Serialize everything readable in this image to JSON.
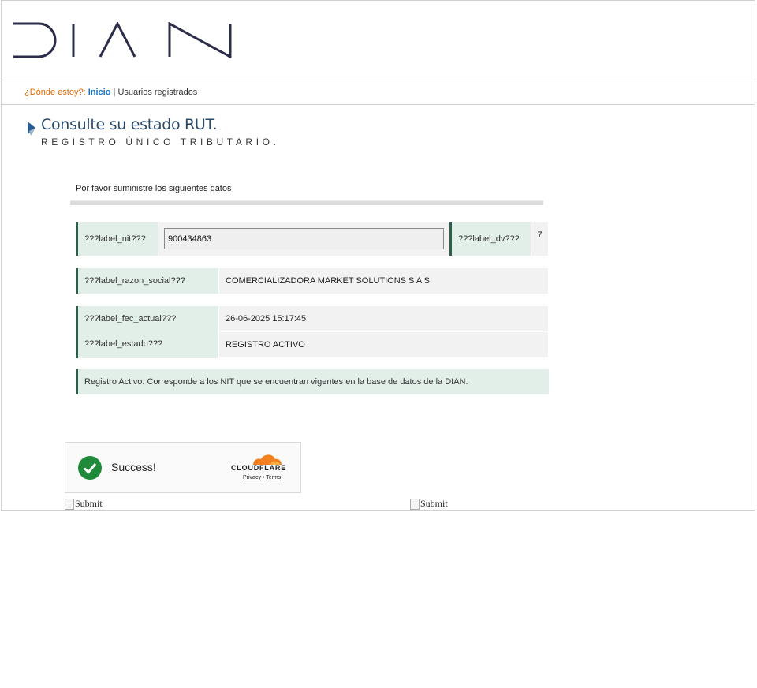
{
  "header": {
    "logo_text": "DIAN"
  },
  "breadcrumb": {
    "where": "¿Dónde estoy?:",
    "home": "Inicio",
    "separator": "|",
    "current": "Usuarios registrados"
  },
  "page": {
    "title": "Consulte su estado RUT.",
    "subtitle": "REGISTRO ÚNICO TRIBUTARIO."
  },
  "form": {
    "instructions": "Por favor suministre los siguientes datos",
    "nit": {
      "label": "???label_nit???",
      "value": "900434863"
    },
    "dv": {
      "label": "???label_dv???",
      "value": "7"
    },
    "razon_social": {
      "label": "???label_razon_social???",
      "value": "COMERCIALIZADORA MARKET SOLUTIONS S A S"
    },
    "fecha_actual": {
      "label": "???label_fec_actual???",
      "value": "26-06-2025 15:17:45"
    },
    "estado": {
      "label": "???label_estado???",
      "value": "REGISTRO ACTIVO"
    },
    "note": "Registro Activo: Corresponde a los NIT que se encuentran vigentes en la base de datos de la DIAN."
  },
  "captcha": {
    "status": "Success!",
    "brand": "CLOUDFLARE",
    "privacy": "Privacy",
    "dot": "•",
    "terms": "Terms"
  },
  "buttons": {
    "submit_left": "Submit",
    "submit_right": "Submit"
  },
  "colors": {
    "logo": "#2b2d4a",
    "accent_green": "#2e5e49",
    "label_bg": "#e2efe9",
    "breadcrumb_where": "#e06a00",
    "breadcrumb_link": "#1a73c9",
    "cloudflare_orange": "#f38020",
    "success_green": "#1e8a3a"
  }
}
